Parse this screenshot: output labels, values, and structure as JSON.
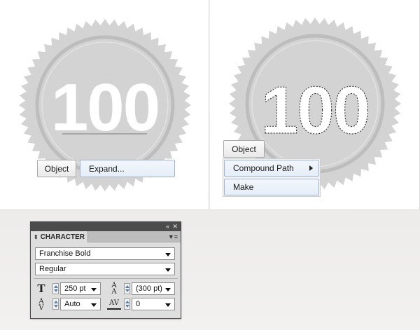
{
  "left_canvas": {
    "badge_number": "100",
    "context_menu": {
      "object_label": "Object",
      "expand_label": "Expand..."
    }
  },
  "right_canvas": {
    "badge_number": "100",
    "context_menu": {
      "object_label": "Object",
      "compound_path_label": "Compound Path",
      "make_label": "Make"
    }
  },
  "character_panel": {
    "tab_label": "CHARACTER",
    "font_family": "Franchise Bold",
    "font_style": "Regular",
    "font_size": "250 pt",
    "leading": "(300 pt)",
    "kerning": "Auto",
    "tracking": "0"
  },
  "colors": {
    "badge_fill": "#d3d3d3",
    "badge_ring": "#bfbfbf",
    "number_fill": "#ffffff",
    "panel_titlebar": "#4b4b4b",
    "menu_highlight": "#e5edf7"
  },
  "icons": {
    "collapse": "double-left-arrow-icon",
    "close": "close-icon",
    "panel_menu": "panel-menu-icon",
    "tab_toggle": "updown-arrows-icon"
  }
}
